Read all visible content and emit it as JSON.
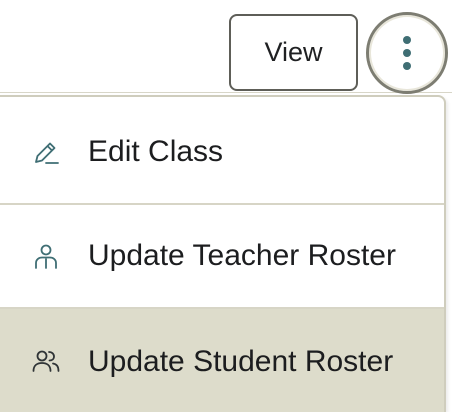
{
  "toolbar": {
    "view_label": "View",
    "more_icon": "kebab-vertical-icon"
  },
  "menu": {
    "items": [
      {
        "label": "Edit Class",
        "icon": "pencil-icon",
        "highlighted": false
      },
      {
        "label": "Update Teacher Roster",
        "icon": "teacher-icon",
        "highlighted": false
      },
      {
        "label": "Update Student Roster",
        "icon": "users-icon",
        "highlighted": true
      }
    ]
  },
  "colors": {
    "accent_teal": "#3f6e74",
    "highlight_bg": "#dddccb",
    "border": "#cfcdbd",
    "text": "#1c1d1f"
  }
}
